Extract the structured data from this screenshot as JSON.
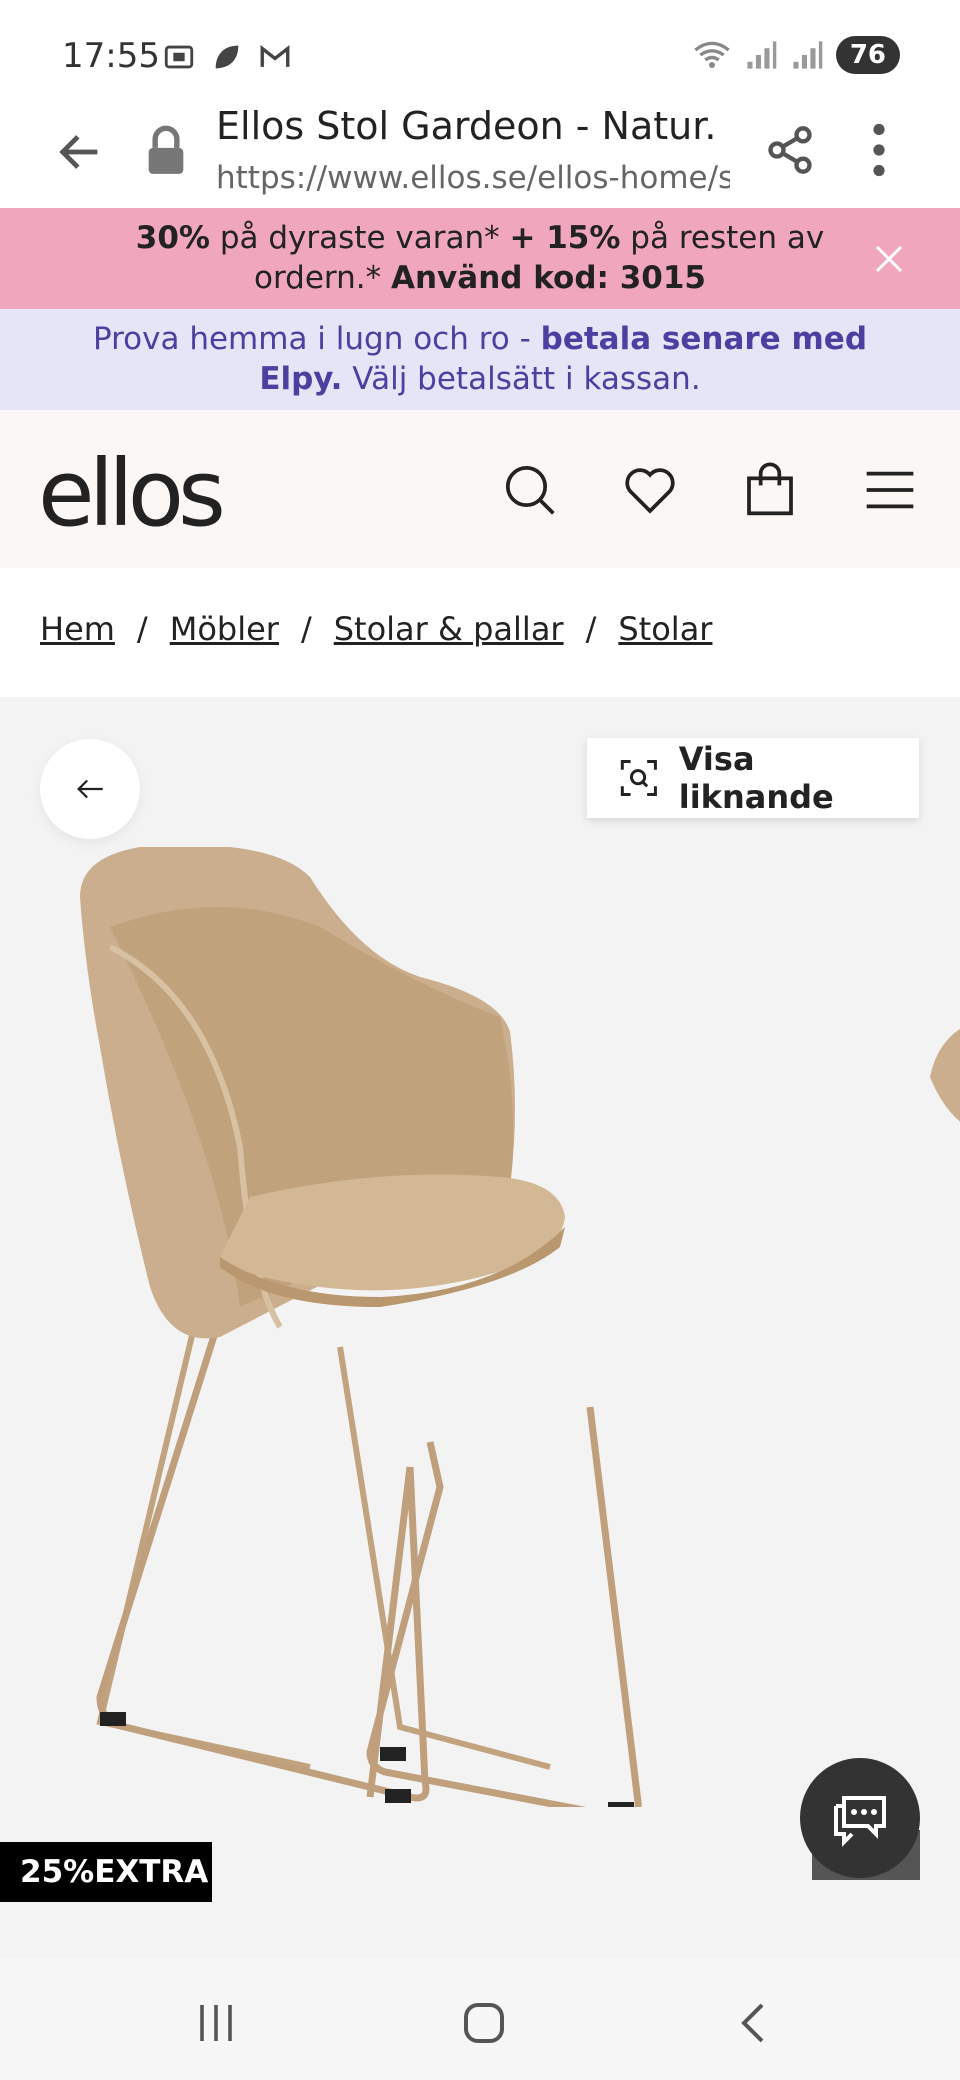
{
  "status": {
    "time": "17:55",
    "battery": "76"
  },
  "url_bar": {
    "title": "Ellos Stol Gardeon - Natur...",
    "address": "https://www.ellos.se/ellos-home/st"
  },
  "promo": {
    "bold1": "30%",
    "text1": " på dyraste varan* ",
    "bold2": "+ 15%",
    "text2": " på resten av",
    "text3": "ordern.* ",
    "bold3": "Använd kod: 3015"
  },
  "elpy": {
    "text1": "Prova hemma i lugn och ro - ",
    "bold1": "betala senare med",
    "bold2": "Elpy.",
    "text2": " Välj betalsätt i kassan."
  },
  "header": {
    "logo": "ellos"
  },
  "breadcrumb": {
    "items": [
      "Hem",
      "Möbler",
      "Stolar & pallar",
      "Stolar"
    ],
    "separator": "/"
  },
  "gallery": {
    "visa_label": "Visa liknande",
    "badge": "25%EXTRA"
  },
  "colors": {
    "promo_bg": "#f0a7bd",
    "elpy_bg": "#e6e4f7",
    "elpy_text": "#4b3fa0",
    "header_bg": "#faf7f4",
    "chair": "#c9ad8c"
  }
}
